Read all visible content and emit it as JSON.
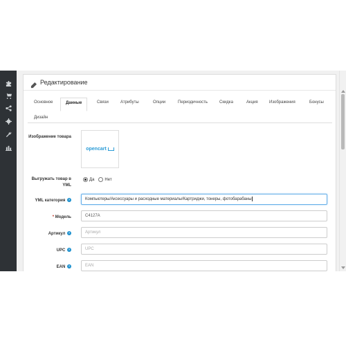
{
  "panel": {
    "title": "Редактирование"
  },
  "sidebar": {
    "icons": [
      "puzzle-icon",
      "cart-icon",
      "share-icon",
      "gear-icon",
      "wrench-icon",
      "bar-chart-icon"
    ]
  },
  "tabs": [
    {
      "label": "Основное"
    },
    {
      "label": "Данные"
    },
    {
      "label": "Связи"
    },
    {
      "label": "Атрибуты"
    },
    {
      "label": "Опции"
    },
    {
      "label": "Периодичность"
    },
    {
      "label": "Скидка"
    },
    {
      "label": "Акция"
    },
    {
      "label": "Изображения"
    },
    {
      "label": "Бонусы"
    },
    {
      "label": "Дизайн"
    }
  ],
  "active_tab": "Данные",
  "form": {
    "image_label": "Изображение товара",
    "logo_text": "opencart",
    "export_label": "Выгружать товар в YML",
    "export_yes": "Да",
    "export_no": "Нет",
    "yml_category_label": "YML категория",
    "yml_category_value": "Компьютеры/Аксессуары и расходные материалы/Картриджи, тонеры, фотобарабаны",
    "model_label": "Модель",
    "model_value": "C4127A",
    "sku_label": "Артикул",
    "sku_placeholder": "Артикул",
    "upc_label": "UPC",
    "upc_placeholder": "UPC",
    "ean_label": "EAN",
    "ean_placeholder": "EAN"
  },
  "colors": {
    "sidebar": "#2e3236",
    "accent": "#1e91cf",
    "logo": "#2a9bd6"
  }
}
